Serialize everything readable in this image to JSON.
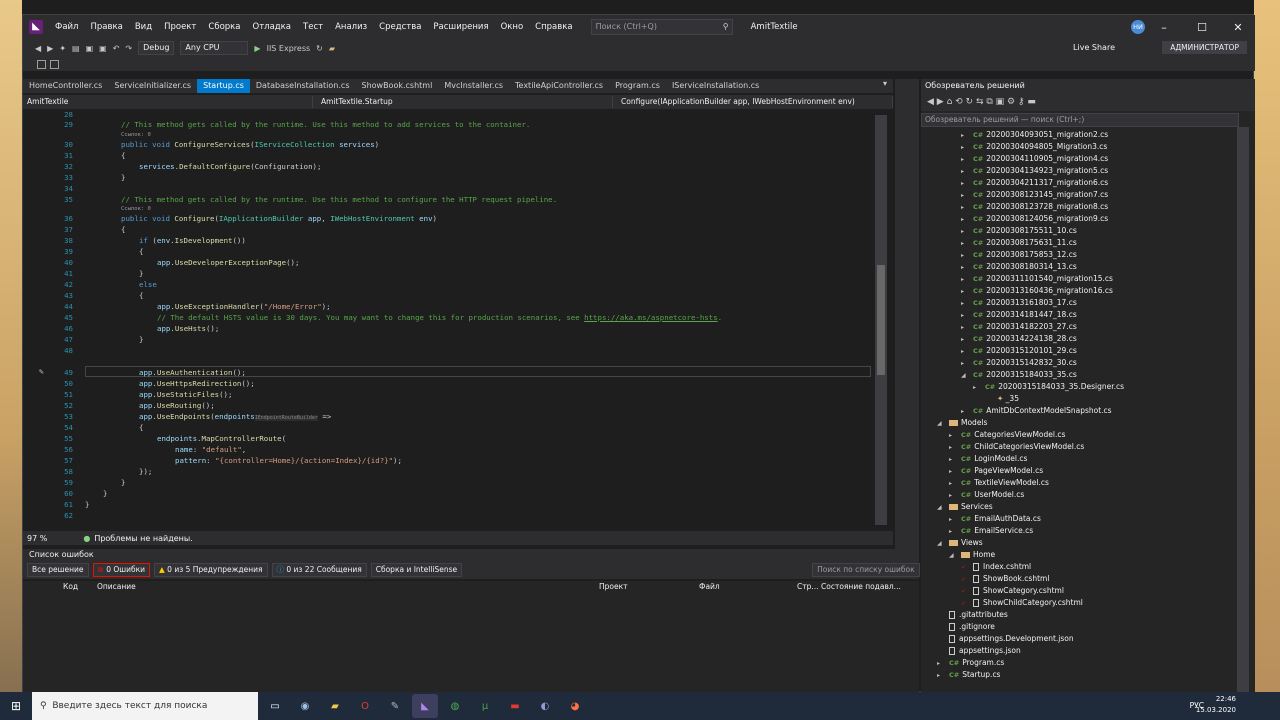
{
  "menu": [
    "Файл",
    "Правка",
    "Вид",
    "Проект",
    "Сборка",
    "Отладка",
    "Тест",
    "Анализ",
    "Средства",
    "Расширения",
    "Окно",
    "Справка"
  ],
  "quick_launch": "Поиск (Ctrl+Q)",
  "solution_name": "AmitTextile",
  "user_initials": "НИ",
  "admin_label": "АДМИНИСТРАТОР",
  "live_share": "Live Share",
  "toolbar": {
    "config": "Debug",
    "platform": "Any CPU",
    "run": "IIS Express"
  },
  "tabs": [
    "HomeController.cs",
    "ServiceInitializer.cs",
    "Startup.cs",
    "DatabaseInstallation.cs",
    "ShowBook.cshtml",
    "MvcInstaller.cs",
    "TextileApiController.cs",
    "Program.cs",
    "IServiceInstallation.cs"
  ],
  "navbar": {
    "project": "AmitTextile",
    "class": "AmitTextile.Startup",
    "member": "Configure(IApplicationBuilder app, IWebHostEnvironment env)"
  },
  "code": {
    "l28": "28",
    "c29": "// This method gets called by the runtime. Use this method to add services to the container.",
    "refs0": "Ссылок: 0",
    "c35": "// This method gets called by the runtime. Use this method to configure the HTTP request pipeline.",
    "c43": "// The default HSTS value is 30 days. You may want to change this for production scenarios, see ",
    "link43": "https://aka.ms/aspnetcore-hsts",
    "hint": "IEndpointRouteBuilder",
    "route_name": "\"default\"",
    "route_pattern": "\"{controller=Home}/{action=Index}/{id?}\"",
    "error_path": "\"/Home/Error\""
  },
  "editor_status": {
    "zoom": "97 %",
    "issues": "Проблемы не найдены."
  },
  "error_list": {
    "title": "Список ошибок",
    "scope": "Все решение",
    "errors": "0 Ошибки",
    "warnings": "0 из 5 Предупреждения",
    "messages": "0 из 22 Сообщения",
    "build": "Сборка и IntelliSense",
    "search": "Поиск по списку ошибок",
    "cols": [
      "Код",
      "Описание",
      "Проект",
      "Файл",
      "Стр...",
      "Состояние подавл..."
    ]
  },
  "solution_explorer": {
    "title": "Обозреватель решений",
    "search": "Обозреватель решений — поиск (Ctrl+;)",
    "items": [
      "20200304093051_migration2.cs",
      "20200304094805_Migration3.cs",
      "20200304110905_migration4.cs",
      "20200304134923_migration5.cs",
      "20200304211317_migration6.cs",
      "20200308123145_migration7.cs",
      "20200308123728_migration8.cs",
      "20200308124056_migration9.cs",
      "20200308175511_10.cs",
      "20200308175631_11.cs",
      "20200308175853_12.cs",
      "20200308180314_13.cs",
      "20200311101540_migration15.cs",
      "20200313160436_migration16.cs",
      "20200313161803_17.cs",
      "20200314181447_18.cs",
      "20200314182203_27.cs",
      "20200314224138_28.cs",
      "20200315120101_29.cs",
      "20200315142832_30.cs",
      "20200315184033_35.cs"
    ],
    "designer": "20200315184033_35.Designer.cs",
    "class35": "_35",
    "snapshot": "AmitDbContextModelSnapshot.cs",
    "models": "Models",
    "model_items": [
      "CategoriesViewModel.cs",
      "ChildCategoriesViewModel.cs",
      "LoginModel.cs",
      "PageViewModel.cs",
      "TextileViewModel.cs",
      "UserModel.cs"
    ],
    "services": "Services",
    "service_items": [
      "EmailAuthData.cs",
      "EmailService.cs"
    ],
    "views": "Views",
    "home": "Home",
    "view_items": [
      "Index.cshtml",
      "ShowBook.cshtml",
      "ShowCategory.cshtml",
      "ShowChildCategory.cshtml"
    ],
    "root_items": [
      ".gitattributes",
      ".gitignore",
      "appsettings.Development.json",
      "appsettings.json",
      "Program.cs",
      "Startup.cs"
    ]
  },
  "taskbar": {
    "search": "Введите здесь текст для поиска",
    "lang": "РУС",
    "time": "22:46",
    "date": "15.03.2020"
  }
}
